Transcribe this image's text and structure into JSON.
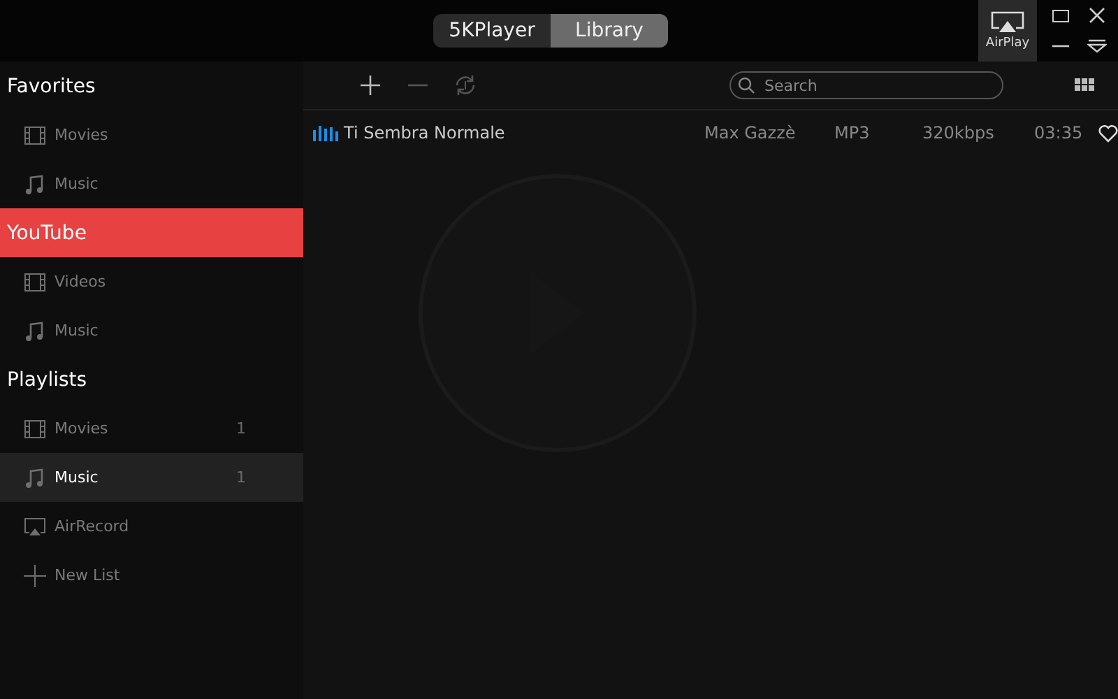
{
  "window": {
    "tabs": [
      {
        "label": "5KPlayer",
        "selected": false
      },
      {
        "label": "Library",
        "selected": true
      }
    ],
    "airplay": {
      "label": "AirPlay"
    }
  },
  "sidebar": {
    "sections": [
      {
        "title": "Favorites",
        "selected": false,
        "items": [
          {
            "kind": "film",
            "label": "Movies",
            "selected": false
          },
          {
            "kind": "music",
            "label": "Music",
            "selected": false
          }
        ]
      },
      {
        "title": "YouTube",
        "selected": true,
        "items": [
          {
            "kind": "film",
            "label": "Videos",
            "selected": false
          },
          {
            "kind": "music",
            "label": "Music",
            "selected": false
          }
        ]
      },
      {
        "title": "Playlists",
        "selected": false,
        "items": [
          {
            "kind": "film",
            "label": "Movies",
            "count": "1",
            "selected": false
          },
          {
            "kind": "music",
            "label": "Music",
            "count": "1",
            "selected": true
          },
          {
            "kind": "screen",
            "label": "AirRecord",
            "selected": false
          },
          {
            "kind": "plus",
            "label": "New List",
            "selected": false
          }
        ]
      }
    ]
  },
  "toolbar": {
    "search": {
      "placeholder": "Search"
    }
  },
  "tracks": [
    {
      "title": "Ti Sembra Normale",
      "artist": "Max Gazzè",
      "format": "MP3",
      "bitrate": "320kbps",
      "duration": "03:35",
      "playing": true,
      "favorite": false
    }
  ]
}
